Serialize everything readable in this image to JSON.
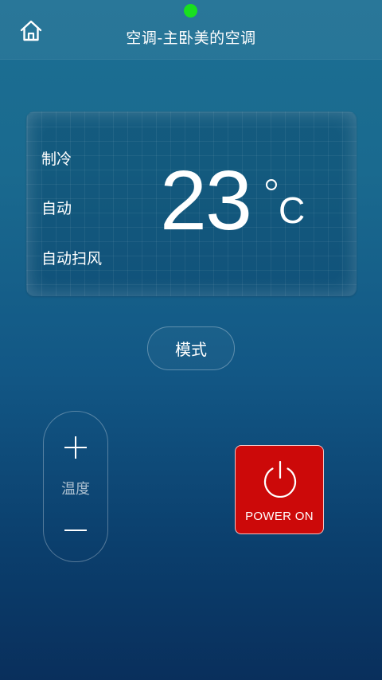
{
  "header": {
    "title": "空调-主卧美的空调",
    "home_icon": "home-icon",
    "status_color": "#19e01f"
  },
  "display": {
    "mode": "制冷",
    "fan_speed": "自动",
    "swing": "自动扫风",
    "temperature": "23",
    "unit": "C"
  },
  "controls": {
    "mode_label": "模式",
    "temperature_label": "温度",
    "plus_icon": "plus-icon",
    "minus_icon": "minus-icon"
  },
  "power": {
    "label": "POWER ON",
    "icon": "power-icon",
    "color": "#cc0909"
  }
}
